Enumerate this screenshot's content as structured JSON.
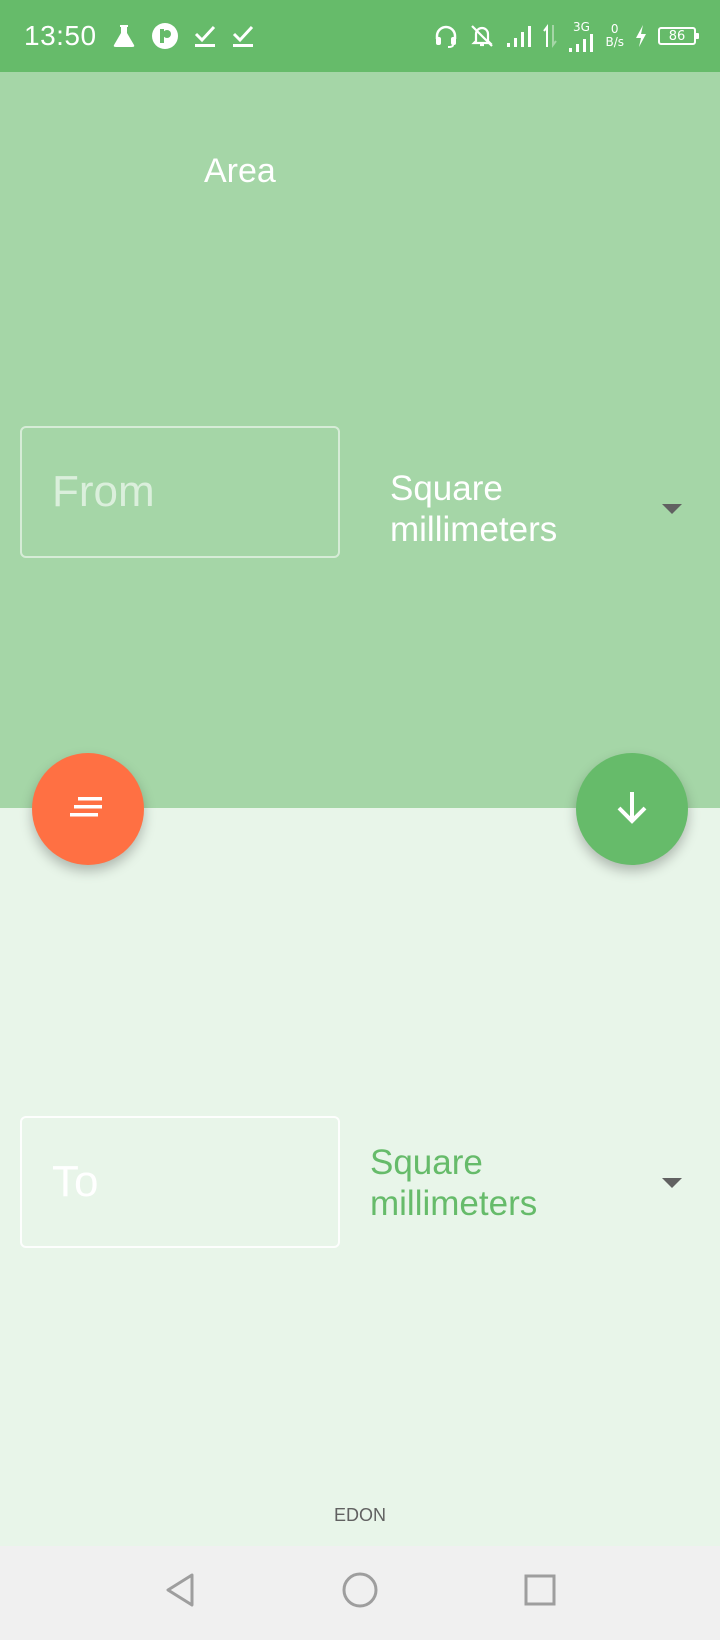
{
  "status_bar": {
    "time": "13:50",
    "left_icons": [
      "flask-icon",
      "circle-p-icon",
      "check-icon",
      "check-icon"
    ],
    "right_icons": [
      "headset-icon",
      "bell-off-icon",
      "signal-icon",
      "data-arrows-icon",
      "signal-3g-icon",
      "network-speed",
      "charging-icon",
      "battery-icon"
    ],
    "network_type": "3G",
    "net_speed_value": "0",
    "net_speed_unit": "B/s",
    "battery_level": "86"
  },
  "header": {
    "title": "Area"
  },
  "from": {
    "placeholder": "From",
    "value": "",
    "unit": "Square millimeters"
  },
  "to": {
    "placeholder": "To",
    "value": "",
    "unit": "Square millimeters"
  },
  "actions": {
    "clear_icon": "clear-lines-icon",
    "convert_icon": "arrow-down-icon"
  },
  "footer": {
    "brand": "EDON"
  },
  "nav_bar": {
    "buttons": [
      "back-icon",
      "home-icon",
      "recents-icon"
    ]
  },
  "colors": {
    "status_bar": "#66bb6a",
    "top_section": "#a5d6a7",
    "bottom_section": "#e8f5e9",
    "accent_green": "#66bb6a",
    "accent_orange": "#ff7043",
    "nav_bar": "#f0f0f0"
  }
}
